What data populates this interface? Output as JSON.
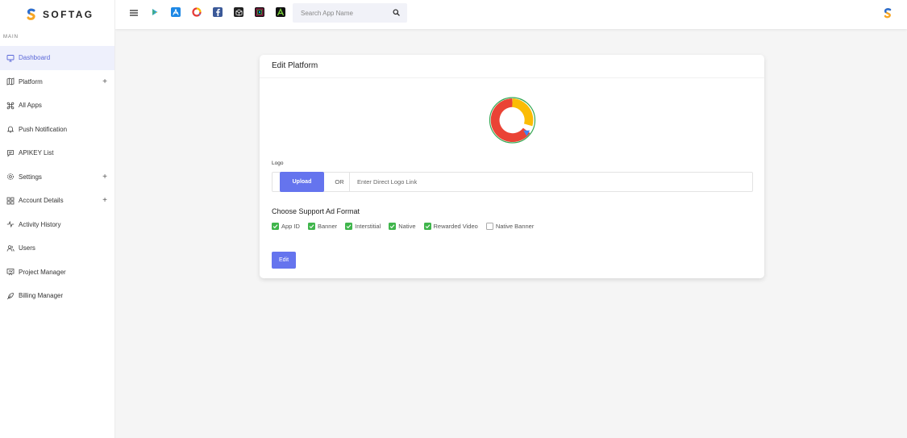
{
  "brand": {
    "name": "SOFTAG"
  },
  "sidebar": {
    "section": "MAIN",
    "items": [
      {
        "label": "Dashboard",
        "icon": "monitor-icon",
        "active": true,
        "expandable": false
      },
      {
        "label": "Platform",
        "icon": "map-icon",
        "active": false,
        "expandable": true
      },
      {
        "label": "All Apps",
        "icon": "command-icon",
        "active": false,
        "expandable": false
      },
      {
        "label": "Push Notification",
        "icon": "bell-icon",
        "active": false,
        "expandable": false
      },
      {
        "label": "APIKEY List",
        "icon": "message-icon",
        "active": false,
        "expandable": false
      },
      {
        "label": "Settings",
        "icon": "gear-icon",
        "active": false,
        "expandable": true
      },
      {
        "label": "Account Details",
        "icon": "grid-icon",
        "active": false,
        "expandable": true
      },
      {
        "label": "Activity History",
        "icon": "activity-icon",
        "active": false,
        "expandable": false
      },
      {
        "label": "Users",
        "icon": "users-icon",
        "active": false,
        "expandable": false
      },
      {
        "label": "Project Manager",
        "icon": "presentation-icon",
        "active": false,
        "expandable": false
      },
      {
        "label": "Billing Manager",
        "icon": "feather-icon",
        "active": false,
        "expandable": false
      }
    ],
    "plus": "+"
  },
  "topbar": {
    "search_placeholder": "Search App Name",
    "platform_icons": [
      "google-play-icon",
      "app-store-icon",
      "custom-platform-icon",
      "facebook-icon",
      "unity-icon",
      "pixel-icon",
      "applovin-icon"
    ]
  },
  "card": {
    "title": "Edit Platform",
    "logo_label": "Logo",
    "upload_label": "Upload",
    "or_label": "OR",
    "link_placeholder": "Enter Direct Logo Link",
    "format_heading": "Choose Support Ad Format",
    "formats": [
      {
        "label": "App ID",
        "checked": true
      },
      {
        "label": "Banner",
        "checked": true
      },
      {
        "label": "Interstitial",
        "checked": true
      },
      {
        "label": "Native",
        "checked": true
      },
      {
        "label": "Rewarded Video",
        "checked": true
      },
      {
        "label": "Native Banner",
        "checked": false
      }
    ],
    "edit_label": "Edit"
  },
  "colors": {
    "accent": "#6574ee",
    "check": "#3fb54b",
    "active_bg": "#eef0fc"
  }
}
